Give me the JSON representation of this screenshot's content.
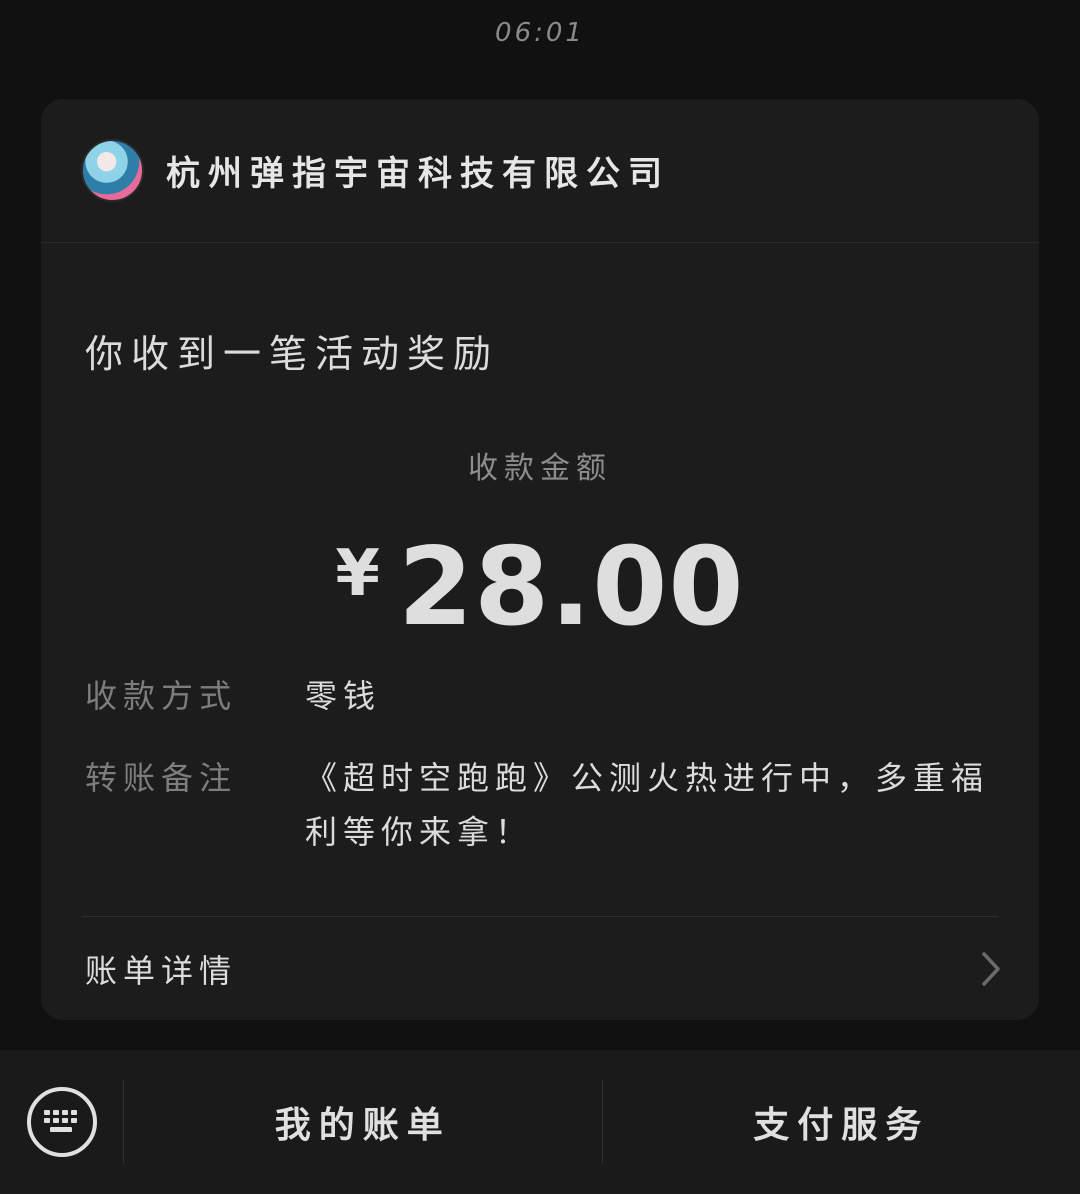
{
  "status_bar": {
    "time": "06:01"
  },
  "card": {
    "company_name": "杭州弹指宇宙科技有限公司",
    "message_title": "你收到一笔活动奖励",
    "amount_label": "收款金额",
    "currency_symbol": "¥",
    "amount": "28.00",
    "details": [
      {
        "label": "收款方式",
        "value": "零钱"
      },
      {
        "label": "转账备注",
        "value": "《超时空跑跑》公测火热进行中，多重福利等你来拿！"
      }
    ],
    "bill_details_label": "账单详情"
  },
  "bottom_menu": {
    "items": [
      {
        "label": "我的账单"
      },
      {
        "label": "支付服务"
      }
    ]
  },
  "icons": [
    "avatar",
    "chevron-right-icon",
    "keyboard-icon"
  ]
}
